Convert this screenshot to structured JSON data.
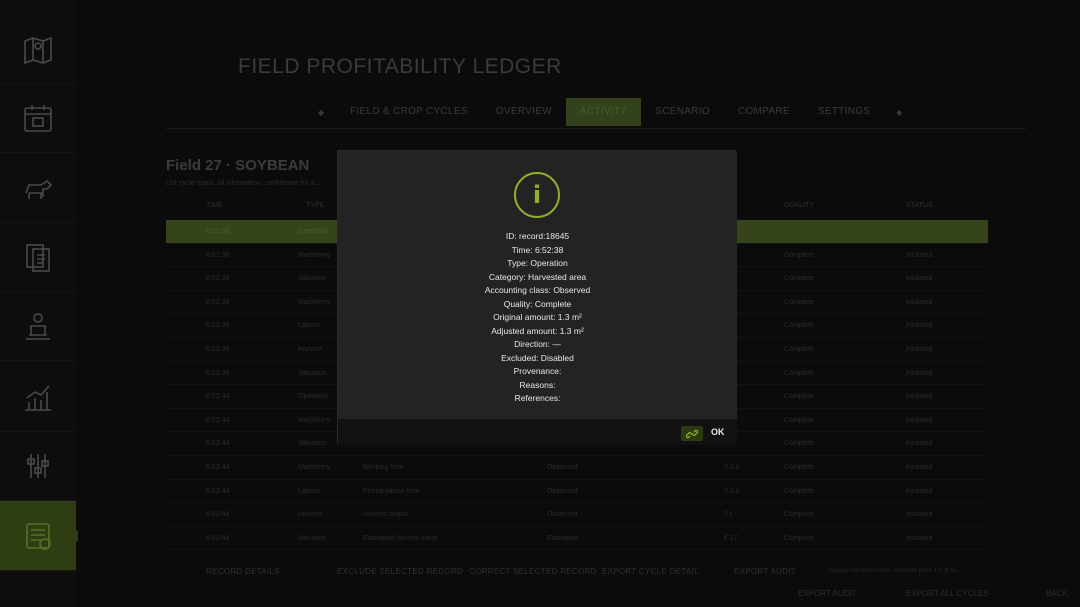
{
  "colors": {
    "accent": "#8fb02c",
    "accent_dark": "#33421a",
    "background": "#0b0b0b",
    "modal": "#232323"
  },
  "sidebar": {
    "items": [
      {
        "icon": "map-icon"
      },
      {
        "icon": "calendar-icon"
      },
      {
        "icon": "livestock-icon"
      },
      {
        "icon": "contracts-icon"
      },
      {
        "icon": "production-icon"
      },
      {
        "icon": "statistics-icon"
      },
      {
        "icon": "settings-icon"
      },
      {
        "icon": "ledger-icon",
        "active": true
      }
    ]
  },
  "header": {
    "title": "FIELD PROFITABILITY LEDGER",
    "tabs": [
      "FIELD & CROP CYCLES",
      "OVERVIEW",
      "ACTIVITY",
      "SCENARIO",
      "COMPARE",
      "SETTINGS"
    ],
    "active_tab": "ACTIVITY"
  },
  "field": {
    "title": "Field 27  ·  SOYBEAN",
    "subtitle": "List cycle totals, all information, confidence for a..."
  },
  "table": {
    "headers": [
      "TIME",
      "TYPE",
      "QUALITY",
      "STATUS"
    ],
    "rows": [
      {
        "time": "6:52:38",
        "type": "Operation",
        "category": "",
        "accounting": "",
        "amount": "",
        "quality": "",
        "status": ""
      },
      {
        "time": "6:52:38",
        "type": "Machinery",
        "category": "",
        "accounting": "",
        "amount": "",
        "quality": "Complete",
        "status": "Included"
      },
      {
        "time": "6:52:38",
        "type": "Valuation",
        "category": "",
        "accounting": "",
        "amount": "",
        "quality": "Complete",
        "status": "Included"
      },
      {
        "time": "6:52:38",
        "type": "Machinery",
        "category": "",
        "accounting": "",
        "amount": "",
        "quality": "Complete",
        "status": "Included"
      },
      {
        "time": "6:52:38",
        "type": "Labour",
        "category": "",
        "accounting": "",
        "amount": "",
        "quality": "Complete",
        "status": "Included"
      },
      {
        "time": "6:52:38",
        "type": "Harvest",
        "category": "",
        "accounting": "",
        "amount": "",
        "quality": "Complete",
        "status": "Included"
      },
      {
        "time": "6:52:38",
        "type": "Valuation",
        "category": "",
        "accounting": "",
        "amount": "",
        "quality": "Complete",
        "status": "Included"
      },
      {
        "time": "6:52:44",
        "type": "Operation",
        "category": "",
        "accounting": "",
        "amount": "",
        "quality": "Complete",
        "status": "Included"
      },
      {
        "time": "6:52:44",
        "type": "Machinery",
        "category": "",
        "accounting": "",
        "amount": "",
        "quality": "Complete",
        "status": "Included"
      },
      {
        "time": "6:52:44",
        "type": "Valuation",
        "category": "",
        "accounting": "",
        "amount": "",
        "quality": "Complete",
        "status": "Included"
      },
      {
        "time": "6:52:44",
        "type": "Machinery",
        "category": "Working time",
        "accounting": "Observed",
        "amount": "0.3 s",
        "quality": "Complete",
        "status": "Included"
      },
      {
        "time": "6:52:44",
        "type": "Labour",
        "category": "Period labour time",
        "accounting": "Observed",
        "amount": "0.3 s",
        "quality": "Complete",
        "status": "Included"
      },
      {
        "time": "6:52:44",
        "type": "Harvest",
        "category": "Harvest output",
        "accounting": "Observed",
        "amount": "5 L",
        "quality": "Complete",
        "status": "Included"
      },
      {
        "time": "6:52:44",
        "type": "Valuation",
        "category": "Estimated harvest value",
        "accounting": "Estimated",
        "amount": "€ 17",
        "quality": "Complete",
        "status": "Included"
      }
    ]
  },
  "actions": [
    "RECORD DETAILS",
    "EXCLUDE SELECTED RECORD",
    "CORRECT SELECTED RECORD",
    "EXPORT CYCLE DETAIL",
    "EXPORT AUDIT"
  ],
  "hint": "Display Harvested area. Estimate plate 1% of fa...",
  "footer": {
    "export_audit": "EXPORT AUDIT",
    "export_all": "EXPORT ALL CYCLES",
    "back": "BACK"
  },
  "modal": {
    "icon": "info-icon",
    "icon_glyph": "i",
    "lines": [
      "ID: record:18645",
      "Time: 6:52:38",
      "Type: Operation",
      "Category: Harvested area",
      "Accounting class: Observed",
      "Quality: Complete",
      "Original amount: 1.3 m²",
      "Adjusted amount: 1.3 m²",
      "Direction: —",
      "Excluded: Disabled",
      "Provenance:",
      "Reasons:",
      "References:"
    ],
    "ok_label": "OK",
    "ok_key_icon": "link-key-icon"
  }
}
